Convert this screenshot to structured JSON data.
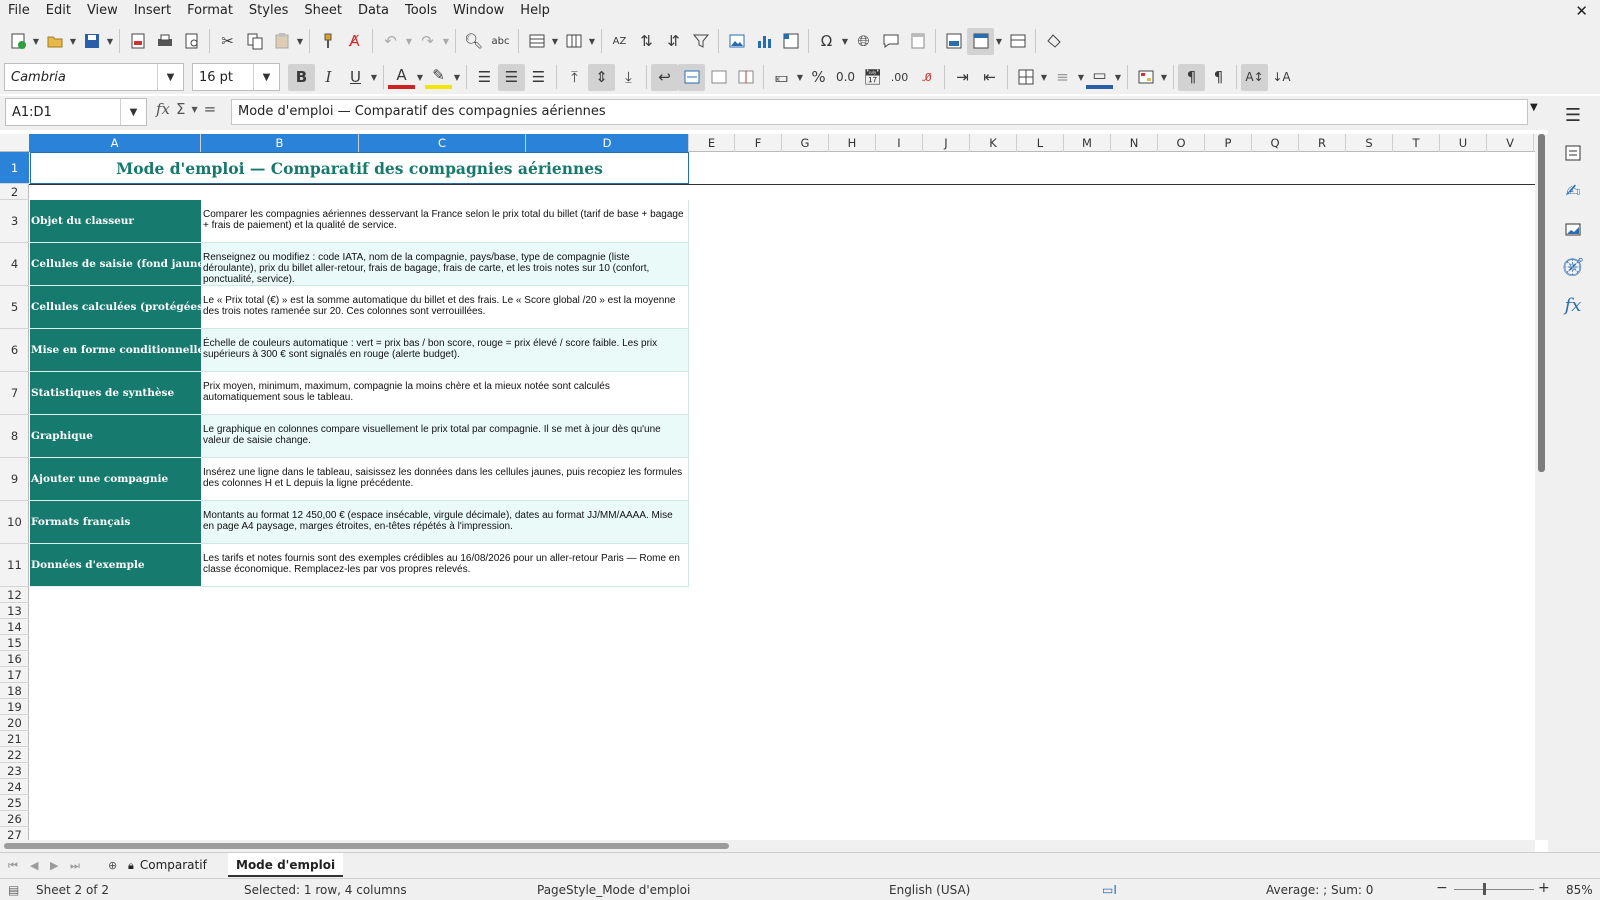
{
  "menu": [
    "File",
    "Edit",
    "View",
    "Insert",
    "Format",
    "Styles",
    "Sheet",
    "Data",
    "Tools",
    "Window",
    "Help"
  ],
  "font": {
    "name": "Cambria",
    "size": "16 pt"
  },
  "namebox": "A1:D1",
  "formula": "Mode d'emploi — Comparatif des compagnies aériennes",
  "columns": [
    "A",
    "B",
    "C",
    "D",
    "E",
    "F",
    "G",
    "H",
    "I",
    "J",
    "K",
    "L",
    "M",
    "N",
    "O",
    "P",
    "Q",
    "R",
    "S",
    "T",
    "U",
    "V"
  ],
  "rows": [
    "1",
    "2",
    "3",
    "4",
    "5",
    "6",
    "7",
    "8",
    "9",
    "10",
    "11",
    "12",
    "13",
    "14",
    "15",
    "16",
    "17",
    "18",
    "19",
    "20",
    "21",
    "22",
    "23",
    "24",
    "25",
    "26",
    "27"
  ],
  "sheet": {
    "title": "Mode d'emploi — Comparatif des compagnies aériennes",
    "items": [
      {
        "label": "Objet du classeur",
        "text": "Comparer les compagnies aériennes desservant la France selon le prix total du billet (tarif de base + bagage + frais de paiement) et la qualité de service."
      },
      {
        "label": "Cellules de saisie (fond jaune pâle)",
        "text": "Renseignez ou modifiez : code IATA, nom de la compagnie, pays/base, type de compagnie (liste déroulante), prix du billet aller-retour, frais de bagage, frais de carte, et les trois notes sur 10 (confort, ponctualité, service)."
      },
      {
        "label": "Cellules calculées (protégées)",
        "text": "Le « Prix total (€) » est la somme automatique du billet et des frais. Le « Score global /20 » est la moyenne des trois notes ramenée sur 20. Ces colonnes sont verrouillées."
      },
      {
        "label": "Mise en forme conditionnelle",
        "text": "Échelle de couleurs automatique : vert = prix bas / bon score, rouge = prix élevé / score faible. Les prix supérieurs à 300 € sont signalés en rouge (alerte budget)."
      },
      {
        "label": "Statistiques de synthèse",
        "text": "Prix moyen, minimum, maximum, compagnie la moins chère et la mieux notée sont calculés automatiquement sous le tableau."
      },
      {
        "label": "Graphique",
        "text": "Le graphique en colonnes compare visuellement le prix total par compagnie. Il se met à jour dès qu'une valeur de saisie change."
      },
      {
        "label": "Ajouter une compagnie",
        "text": "Insérez une ligne dans le tableau, saisissez les données dans les cellules jaunes, puis recopiez les formules des colonnes H et L depuis la ligne précédente."
      },
      {
        "label": "Formats français",
        "text": "Montants au format 12 450,00 € (espace insécable, virgule décimale), dates au format JJ/MM/AAAA. Mise en page A4 paysage, marges étroites, en-têtes répétés à l'impression."
      },
      {
        "label": "Données d'exemple",
        "text": "Les tarifs et notes fournis sont des exemples crédibles au 16/08/2026 pour un aller-retour Paris — Rome en classe économique. Remplacez-les par vos propres relevés."
      }
    ]
  },
  "tabs": [
    "Comparatif",
    "Mode d'emploi"
  ],
  "status": {
    "sheet": "Sheet 2 of 2",
    "selection": "Selected: 1 row, 4 columns",
    "pagestyle": "PageStyle_Mode d'emploi",
    "language": "English (USA)",
    "sum": "Average: ; Sum: 0",
    "zoom": "85%"
  },
  "colors": {
    "teal": "#177a6e",
    "title_teal": "#17786c",
    "selection_blue": "#2a83d8",
    "light_teal": "#eafaf8"
  }
}
